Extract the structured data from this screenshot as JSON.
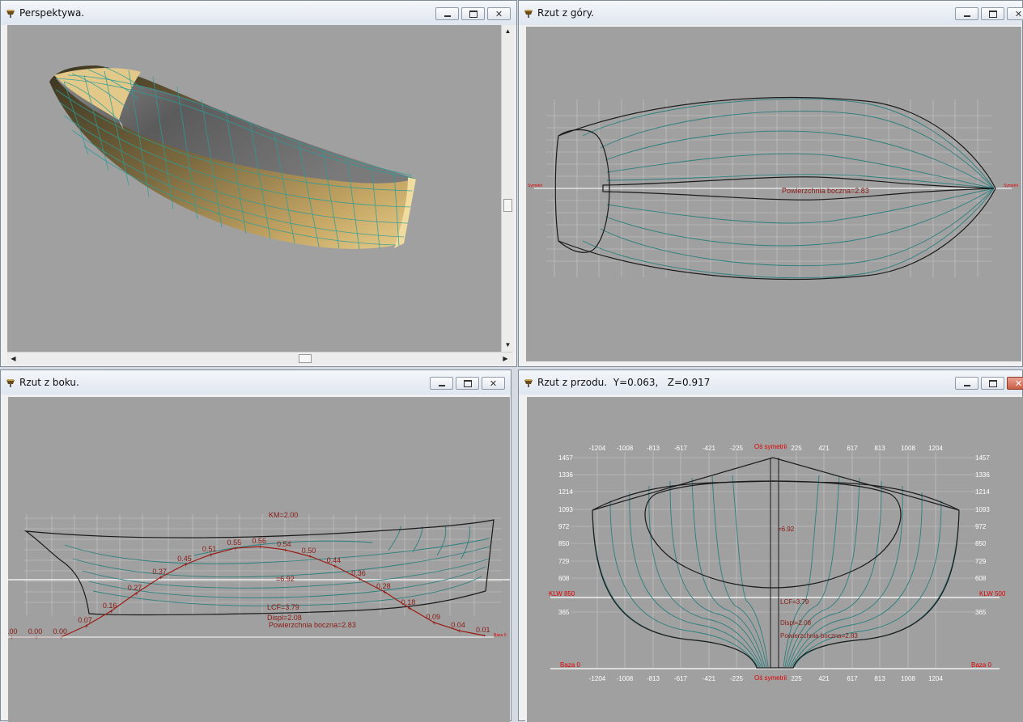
{
  "windows": {
    "perspective": {
      "title": "Perspektywa."
    },
    "top": {
      "title": "Rzut z góry.",
      "label_axis": "Symetrii",
      "label_wetted": "Powierzchnia boczna=2.83"
    },
    "side": {
      "title": "Rzut z boku.",
      "km": "KM=2.00",
      "centroid": "=6.92",
      "lcf": "LCF=3.79",
      "displ": "Displ=2.08",
      "wetted": "Powierzchnia boczna=2.83",
      "curve_values": [
        "0.00",
        "0.00",
        "0.00",
        "0.07",
        "0.16",
        "0.27",
        "0.37",
        "0.45",
        "0.51",
        "0.55",
        "0.56",
        "0.54",
        "0.50",
        "0.44",
        "0.36",
        "0.28",
        "0.18",
        "0.09",
        "0.04",
        "0.01"
      ],
      "baza": "Baza 0"
    },
    "front": {
      "title": "Rzut z przodu.  Y=0.063,   Z=0.917",
      "x_ticks_left": [
        "-1204",
        "-1008",
        "-813",
        "-617",
        "-421",
        "-225"
      ],
      "x_ticks_right": [
        "225",
        "421",
        "617",
        "813",
        "1008",
        "1204"
      ],
      "axis_label": "Oś symetrii",
      "y_ticks": [
        "1457",
        "1336",
        "1214",
        "1093",
        "972",
        "850",
        "729",
        "608",
        "365"
      ],
      "klw_left": "KLW 850",
      "klw_right": "KLW 500",
      "baza": "Baza 0",
      "centroid": "=6.92",
      "lcf": "LCF=3.79",
      "displ": "Displ=2.08",
      "wetted": "Powierzchnia boczna=2.83"
    }
  },
  "icons": {
    "app": "boat-icon",
    "minimize": "minimize-icon",
    "maximize": "maximize-icon",
    "close": "close-icon"
  },
  "colors": {
    "canvas": "#a0a0a0",
    "hull_lines": "#2c7f7e",
    "curve": "#9b1b14",
    "label_red": "#e00000",
    "hull_gold": "#e2c98a"
  }
}
